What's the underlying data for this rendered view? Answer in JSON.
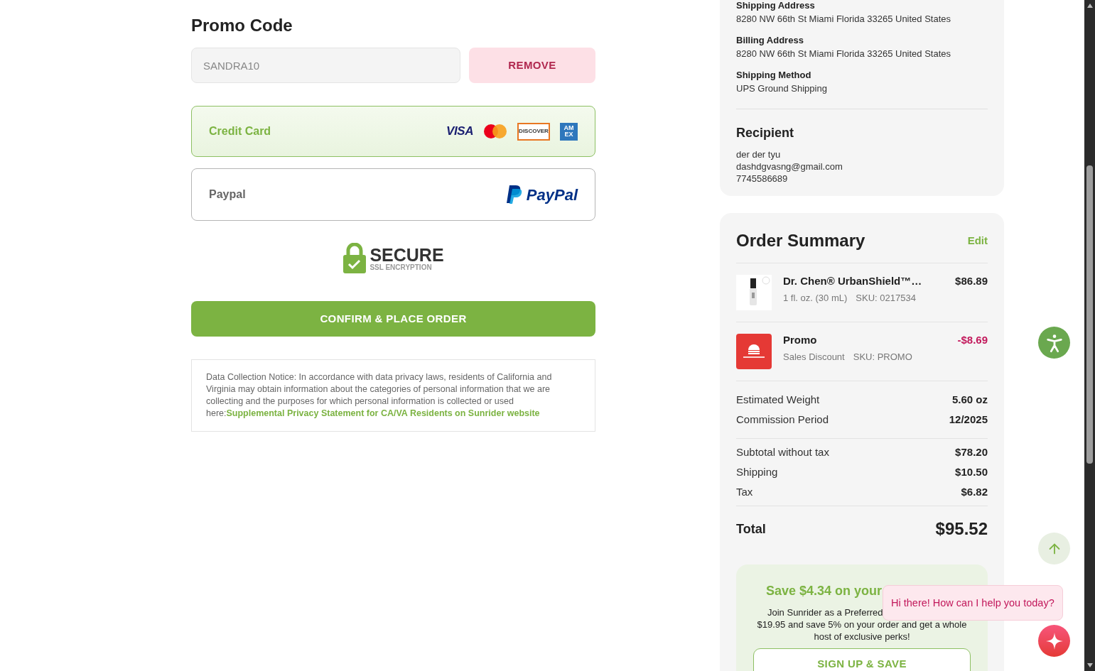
{
  "promo": {
    "heading": "Promo Code",
    "value": "SANDRA10",
    "disabled": true,
    "button": "REMOVE"
  },
  "payment_methods": [
    {
      "kind": "card",
      "label": "Credit Card",
      "selected": true,
      "logos": [
        {
          "kind": "visa",
          "text": "VISA"
        },
        {
          "kind": "mastercard"
        },
        {
          "kind": "discover",
          "text": "DISCOVER"
        },
        {
          "kind": "amex",
          "text": "AM EX"
        }
      ]
    },
    {
      "kind": "paypal",
      "label": "Paypal",
      "selected": false,
      "logo_text": "PayPal"
    }
  ],
  "secure_badge": {
    "title": "SECURE",
    "subtitle": "SSL ENCRYPTION"
  },
  "confirm_button": "CONFIRM & PLACE ORDER",
  "notice": {
    "text": "Data Collection Notice: In accordance with data privacy laws, residents of California and Virginia may obtain information about the categories of personal information that we are collecting and the purposes for which personal information is collected or used here:",
    "link": "Supplemental Privacy Statement for CA/VA Residents on Sunrider website"
  },
  "details": [
    {
      "label": "Shipping Address",
      "value": "8280 NW 66th St Miami Florida 33265 United States"
    },
    {
      "label": "Billing Address",
      "value": "8280 NW 66th St Miami Florida 33265 United States"
    },
    {
      "label": "Shipping Method",
      "value": "UPS Ground Shipping"
    }
  ],
  "recipient": {
    "heading": "Recipient",
    "lines": [
      "der der tyu",
      "dashdgvasng@gmail.com",
      "7745586689"
    ]
  },
  "order_summary": {
    "title": "Order Summary",
    "edit": "Edit",
    "items": [
      {
        "kind": "product",
        "name": "Dr. Chen® UrbanShield™…",
        "variant": "1 fl. oz. (30 mL)",
        "sku": "SKU: 0217534",
        "price": "$86.89",
        "discount": false
      },
      {
        "kind": "promo",
        "name": "Promo",
        "variant": "Sales Discount",
        "sku": "SKU: PROMO",
        "price": "-$8.69",
        "discount": true
      }
    ],
    "info_rows": [
      {
        "label": "Estimated Weight",
        "value": "5.60 oz"
      },
      {
        "label": "Commission Period",
        "value": "12/2025"
      }
    ],
    "cost_rows": [
      {
        "label": "Subtotal without tax",
        "value": "$78.20"
      },
      {
        "label": "Shipping",
        "value": "$10.50"
      },
      {
        "label": "Tax",
        "value": "$6.82"
      }
    ],
    "total": {
      "label": "Total",
      "value": "$95.52"
    }
  },
  "membership_offer": {
    "heading": "Save $4.34 on your",
    "first_line": "Join Sunrider as a Preferred",
    "rest": "$19.95 and save 5% on your order and get a whole host of exclusive perks!",
    "button": "SIGN UP & SAVE"
  },
  "chat_bubble": "Hi there! How can I help you today?"
}
